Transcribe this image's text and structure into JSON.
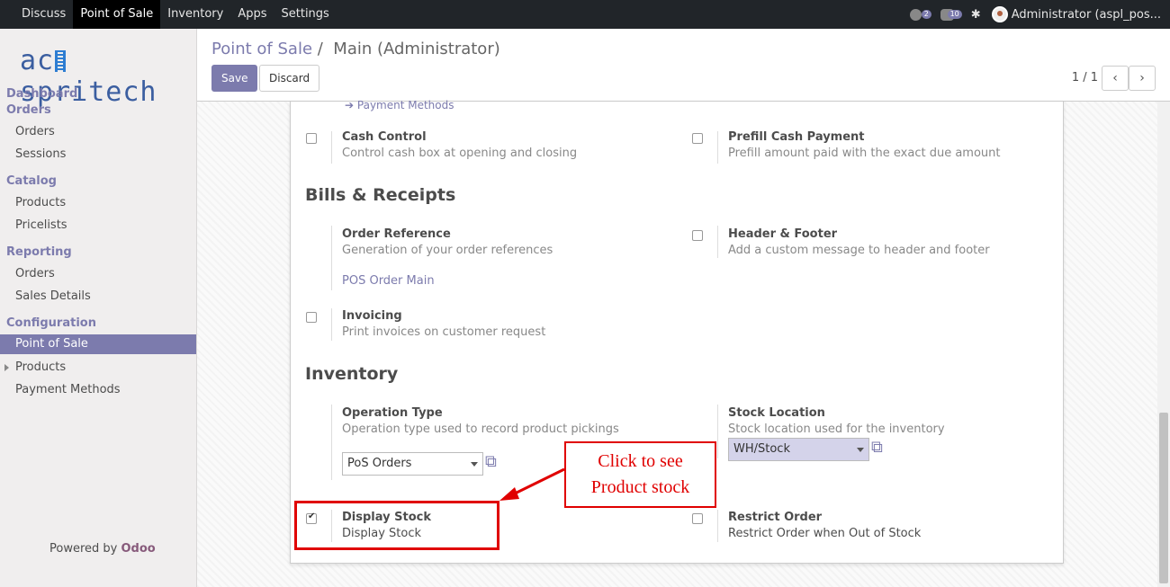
{
  "topbar": {
    "menu": [
      "Discuss",
      "Point of Sale",
      "Inventory",
      "Apps",
      "Settings"
    ],
    "activity_count": "2",
    "messages_count": "10",
    "user": "Administrator (aspl_pos..."
  },
  "sidebar": {
    "logo": "acespritech",
    "dashboard": "Dashboard",
    "orders_head": "Orders",
    "orders": "Orders",
    "sessions": "Sessions",
    "catalog": "Catalog",
    "products": "Products",
    "pricelists": "Pricelists",
    "reporting": "Reporting",
    "rep_orders": "Orders",
    "sales_details": "Sales Details",
    "configuration": "Configuration",
    "point_of_sale": "Point of Sale",
    "cfg_products": "Products",
    "payment_methods": "Payment Methods",
    "powered_by": "Powered by",
    "odoo": "Odoo"
  },
  "control": {
    "breadcrumb_link": "Point of Sale",
    "separator": "/",
    "breadcrumb_current": "Main (Administrator)",
    "save": "Save",
    "discard": "Discard",
    "pager": "1 / 1",
    "prev": "‹",
    "next": "›"
  },
  "form": {
    "payment_methods_link": "Payment Methods",
    "cash_control": {
      "label": "Cash Control",
      "desc": "Control cash box at opening and closing",
      "checked": false
    },
    "prefill_cash": {
      "label": "Prefill Cash Payment",
      "desc": "Prefill amount paid with the exact due amount",
      "checked": false
    },
    "bills_title": "Bills & Receipts",
    "order_ref": {
      "label": "Order Reference",
      "desc": "Generation of your order references",
      "value": "POS Order Main"
    },
    "header_footer": {
      "label": "Header & Footer",
      "desc": "Add a custom message to header and footer",
      "checked": false
    },
    "invoicing": {
      "label": "Invoicing",
      "desc": "Print invoices on customer request",
      "checked": false
    },
    "inventory_title": "Inventory",
    "operation_type": {
      "label": "Operation Type",
      "desc": "Operation type used to record product pickings",
      "value": "PoS Orders"
    },
    "stock_location": {
      "label": "Stock Location",
      "desc": "Stock location used for the inventory",
      "value": "WH/Stock"
    },
    "display_stock": {
      "label": "Display Stock",
      "desc": "Display Stock",
      "checked": true
    },
    "restrict_order": {
      "label": "Restrict Order",
      "desc": "Restrict Order when Out of Stock",
      "checked": false
    }
  },
  "annotation": {
    "line1": "Click to see",
    "line2": "Product stock",
    "color": "#e00000"
  }
}
